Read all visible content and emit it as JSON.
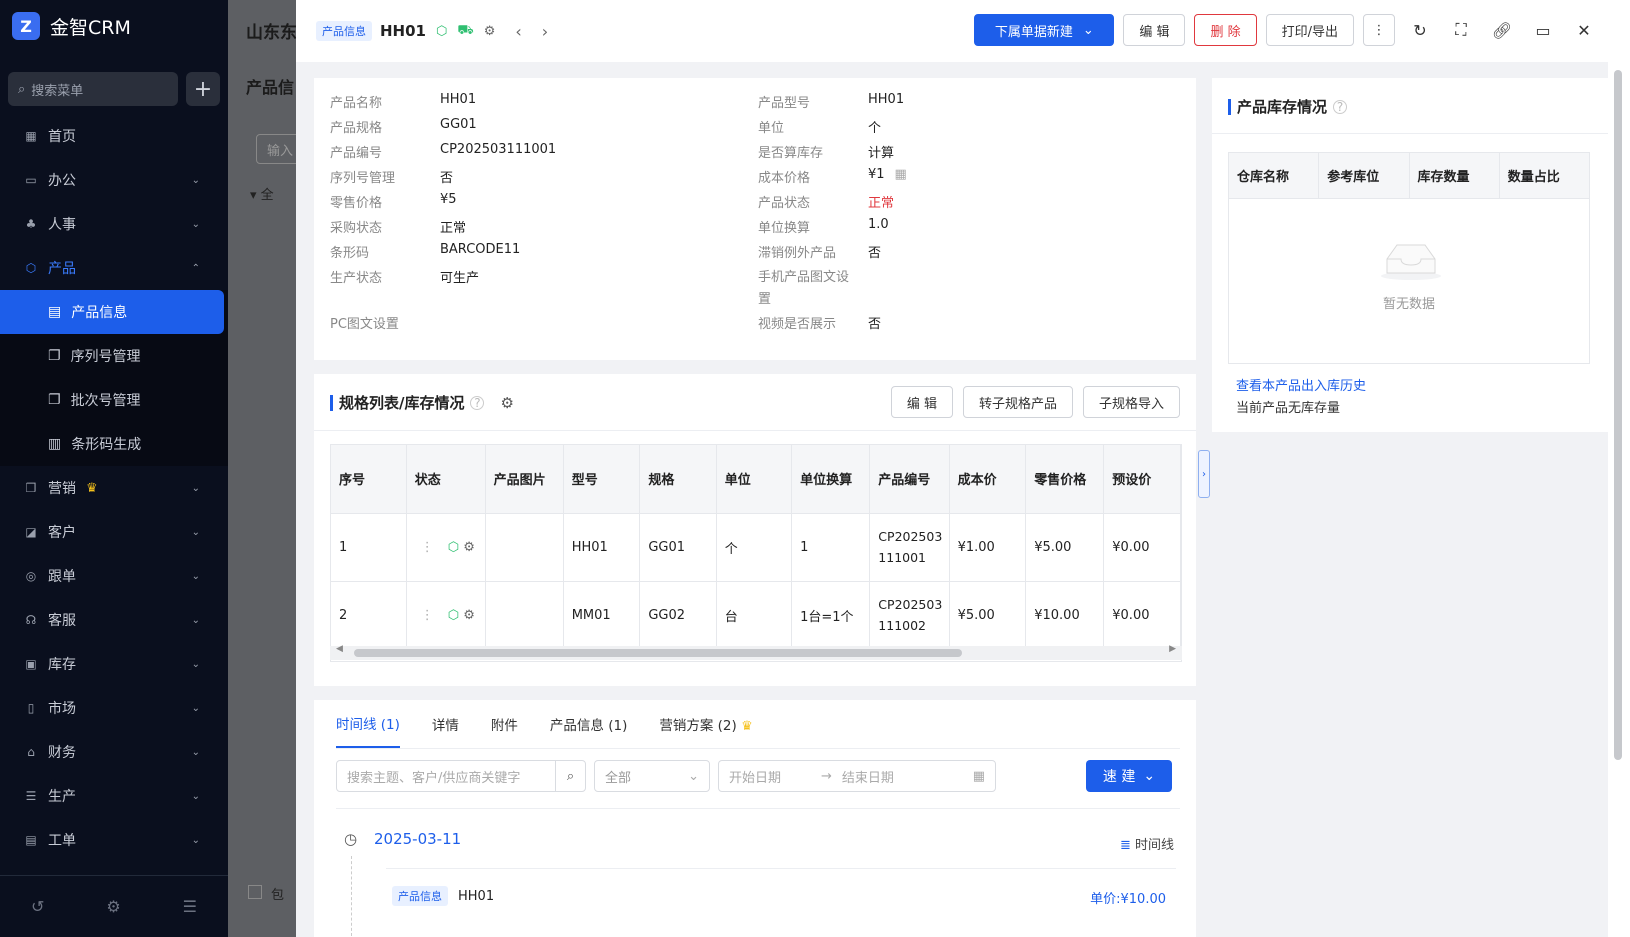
{
  "sidebar": {
    "brand": "金智CRM",
    "search_placeholder": "搜索菜单",
    "menu": [
      {
        "label": "首页",
        "icon": "home-icon"
      },
      {
        "label": "办公",
        "icon": "office-icon"
      },
      {
        "label": "人事",
        "icon": "people-icon"
      },
      {
        "label": "产品",
        "icon": "product-icon"
      },
      {
        "label": "营销",
        "icon": "marketing-icon"
      },
      {
        "label": "客户",
        "icon": "customer-icon"
      },
      {
        "label": "跟单",
        "icon": "follow-icon"
      },
      {
        "label": "客服",
        "icon": "service-icon"
      },
      {
        "label": "库存",
        "icon": "warehouse-icon"
      },
      {
        "label": "市场",
        "icon": "market-icon"
      },
      {
        "label": "财务",
        "icon": "finance-icon"
      },
      {
        "label": "生产",
        "icon": "production-icon"
      },
      {
        "label": "工单",
        "icon": "ticket-icon"
      }
    ],
    "submenu": [
      {
        "label": "产品信息"
      },
      {
        "label": "序列号管理"
      },
      {
        "label": "批次号管理"
      },
      {
        "label": "条形码生成"
      }
    ]
  },
  "background": {
    "title": "山东东",
    "subtitle": "产品信",
    "input_placeholder": "输入",
    "tree_item": "全",
    "checkbox_label": "包"
  },
  "header": {
    "tag": "产品信息",
    "title": "HH01",
    "new_sub_button": "下属单据新建",
    "edit_button": "编 辑",
    "delete_button": "删 除",
    "print_button": "打印/导出"
  },
  "info": {
    "left": [
      {
        "label": "产品名称",
        "value": "HH01"
      },
      {
        "label": "产品规格",
        "value": "GG01"
      },
      {
        "label": "产品编号",
        "value": "CP202503111001"
      },
      {
        "label": "序列号管理",
        "value": "否"
      },
      {
        "label": "零售价格",
        "value": "¥5"
      },
      {
        "label": "采购状态",
        "value": "正常"
      },
      {
        "label": "条形码",
        "value": "BARCODE11"
      },
      {
        "label": "生产状态",
        "value": "可生产"
      },
      {
        "label": "PC图文设置",
        "value": ""
      }
    ],
    "right": [
      {
        "label": "产品型号",
        "value": "HH01"
      },
      {
        "label": "单位",
        "value": "个"
      },
      {
        "label": "是否算库存",
        "value": "计算"
      },
      {
        "label": "成本价格",
        "value": "¥1"
      },
      {
        "label": "产品状态",
        "value": "正常"
      },
      {
        "label": "单位换算",
        "value": "1.0"
      },
      {
        "label": "滞销例外产品",
        "value": "否"
      },
      {
        "label": "手机产品图文设置",
        "value": ""
      },
      {
        "label": "视频是否展示",
        "value": "否"
      }
    ]
  },
  "stock": {
    "title": "产品库存情况",
    "columns": [
      "仓库名称",
      "参考库位",
      "库存数量",
      "数量占比"
    ],
    "empty_text": "暂无数据",
    "history_link": "查看本产品出入库历史",
    "note": "当前产品无库存量"
  },
  "spec": {
    "title": "规格列表/库存情况",
    "actions": [
      "编 辑",
      "转子规格产品",
      "子规格导入"
    ],
    "columns": [
      "序号",
      "状态",
      "产品图片",
      "型号",
      "规格",
      "单位",
      "单位换算",
      "产品编号",
      "成本价",
      "零售价格",
      "预设价"
    ],
    "rows": [
      {
        "no": "1",
        "model": "HH01",
        "spec": "GG01",
        "unit": "个",
        "conv": "1",
        "code_a": "CP202503",
        "code_b": "111001",
        "cost": "¥1.00",
        "retail": "¥5.00",
        "preset": "¥0.00"
      },
      {
        "no": "2",
        "model": "MM01",
        "spec": "GG02",
        "unit": "台",
        "conv": "1台=1个",
        "code_a": "CP202503",
        "code_b": "111002",
        "cost": "¥5.00",
        "retail": "¥10.00",
        "preset": "¥0.00"
      }
    ]
  },
  "timeline": {
    "tabs": [
      "时间线 (1)",
      "详情",
      "附件",
      "产品信息 (1)",
      "营销方案 (2)"
    ],
    "search_placeholder": "搜索主题、客户/供应商关键字",
    "select_value": "全部",
    "start_placeholder": "开始日期",
    "end_placeholder": "结束日期",
    "quick_button": "速 建",
    "date": "2025-03-11",
    "view_switch": "时间线",
    "item_tag": "产品信息",
    "item_title": "HH01",
    "item_price": "单价:¥10.00"
  }
}
